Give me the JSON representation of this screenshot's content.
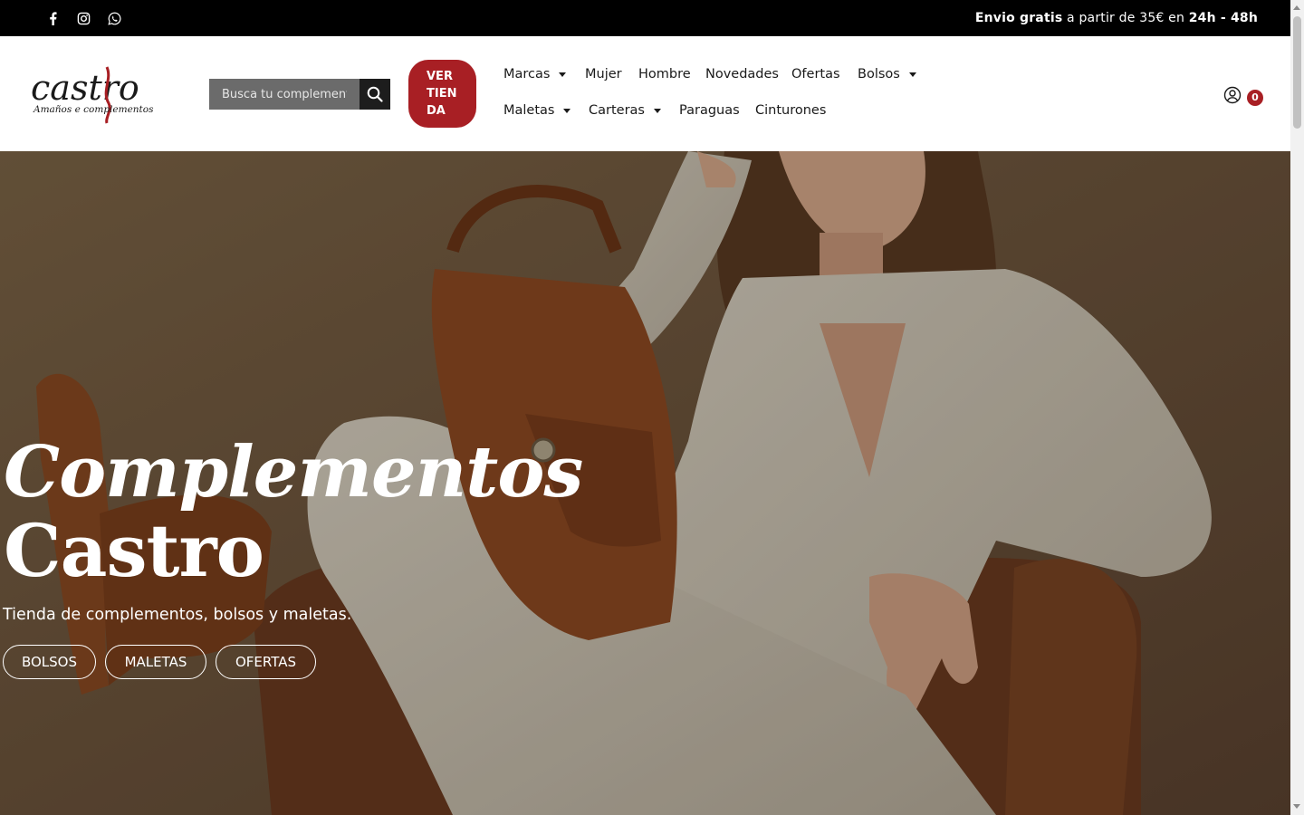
{
  "topbar": {
    "social": [
      "facebook-icon",
      "instagram-icon",
      "whatsapp-icon"
    ],
    "shipping": {
      "bold1": "Envio gratis",
      "mid": " a partir de 35€ en ",
      "bold2": "24h - 48h"
    }
  },
  "header": {
    "logo": {
      "word": "castro",
      "tagline": "Amaños e complementos"
    },
    "search_placeholder": "Busca tu complemento ...",
    "store_button": [
      "VER",
      "TIEN",
      "DA"
    ],
    "nav_row1": [
      "Marcas",
      "Mujer",
      "Hombre",
      "Novedades",
      "Ofertas",
      "Bolsos"
    ],
    "nav_row2": [
      "Maletas",
      "Carteras",
      "Paraguas",
      "Cinturones"
    ],
    "cart_count": "0"
  },
  "hero": {
    "title_line1": "Complementos",
    "title_line2": "Castro",
    "subtitle": "Tienda de complementos, bolsos y maletas.",
    "buttons": [
      "BOLSOS",
      "MALETAS",
      "OFERTAS"
    ]
  },
  "colors": {
    "accent": "#a81f24",
    "topbar": "#000000",
    "search_bg": "#6b6b6b"
  }
}
